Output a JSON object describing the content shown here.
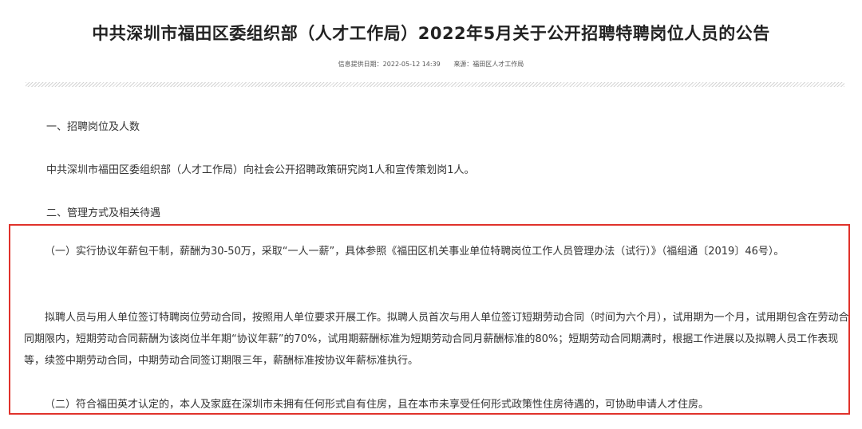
{
  "article": {
    "title": "中共深圳市福田区委组织部（人才工作局）2022年5月关于公开招聘特聘岗位人员的公告",
    "date_label": "信息提供日期：2022-05-12 14:39",
    "source_label": "来源：福田区人才工作局"
  },
  "body": {
    "section1_heading": "一、招聘岗位及人数",
    "section1_text": "中共深圳市福田区委组织部（人才工作局）向社会公开招聘政策研究岗1人和宣传策划岗1人。",
    "section2_heading": "二、管理方式及相关待遇",
    "item1": "（一）实行协议年薪包干制，薪酬为30-50万，采取“一人一薪”，具体参照《福田区机关事业单位特聘岗位工作人员管理办法（试行）》（福组通〔2019〕46号）。",
    "item1_detail": "拟聘人员与用人单位签订特聘岗位劳动合同，按照用人单位要求开展工作。拟聘人员首次与用人单位签订短期劳动合同（时间为六个月），试用期为一个月，试用期包含在劳动合同期限内，短期劳动合同薪酬为该岗位半年期“协议年薪”的70%，试用期薪酬标准为短期劳动合同月薪酬标准的80%；短期劳动合同期满时，根据工作进展以及拟聘人员工作表现等，续签中期劳动合同，中期劳动合同签订期限三年，薪酬标准按协议年薪标准执行。",
    "item2": "（二）符合福田英才认定的，本人及家庭在深圳市未拥有任何形式自有住房，且在本市未享受任何形式政策性住房待遇的，可协助申请人才住房。"
  },
  "colors": {
    "highlight_border": "#e0322b",
    "text": "#333333",
    "title": "#222222"
  }
}
